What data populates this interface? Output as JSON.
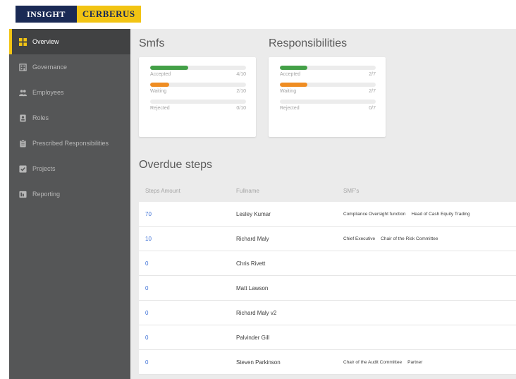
{
  "brand": {
    "left": "INSIGHT",
    "right": "CERBERUS"
  },
  "sidebar": {
    "items": [
      {
        "label": "Overview",
        "icon": "dashboard-icon",
        "active": true
      },
      {
        "label": "Governance",
        "icon": "building-icon"
      },
      {
        "label": "Employees",
        "icon": "people-icon"
      },
      {
        "label": "Roles",
        "icon": "id-badge-icon"
      },
      {
        "label": "Prescribed Responsibilities",
        "icon": "clipboard-icon"
      },
      {
        "label": "Projects",
        "icon": "checkbox-icon"
      },
      {
        "label": "Reporting",
        "icon": "report-icon"
      }
    ]
  },
  "smfs": {
    "title": "Smfs",
    "stats": [
      {
        "label": "Accepted",
        "value": "4/10",
        "fraction": 0.4,
        "color": "#43a047"
      },
      {
        "label": "Waiting",
        "value": "2/10",
        "fraction": 0.2,
        "color": "#ef8d22"
      },
      {
        "label": "Rejected",
        "value": "0/10",
        "fraction": 0.0,
        "color": "#d9d9d9"
      }
    ]
  },
  "responsibilities": {
    "title": "Responsibilities",
    "stats": [
      {
        "label": "Accepted",
        "value": "2/7",
        "fraction": 0.2857,
        "color": "#43a047"
      },
      {
        "label": "Waiting",
        "value": "2/7",
        "fraction": 0.2857,
        "color": "#ef8d22"
      },
      {
        "label": "Rejected",
        "value": "0/7",
        "fraction": 0.0,
        "color": "#d9d9d9"
      }
    ]
  },
  "overdue": {
    "title": "Overdue steps",
    "columns": [
      "Steps Amount",
      "Fullname",
      "SMF's"
    ],
    "rows": [
      {
        "steps": "70",
        "name": "Lesley Kumar",
        "smfs": [
          "Compliance Oversight function",
          "Head of Cash Equity Trading"
        ]
      },
      {
        "steps": "10",
        "name": "Richard Maly",
        "smfs": [
          "Chief Executive",
          "Chair of the Risk Committee"
        ]
      },
      {
        "steps": "0",
        "name": "Chris Rivett",
        "smfs": []
      },
      {
        "steps": "0",
        "name": "Matt Lawson",
        "smfs": []
      },
      {
        "steps": "0",
        "name": "Richard Maly v2",
        "smfs": []
      },
      {
        "steps": "0",
        "name": "Palvinder Gill",
        "smfs": []
      },
      {
        "steps": "0",
        "name": "Steven Parkinson",
        "smfs": [
          "Chair of the Audit Committee",
          "Partner"
        ]
      }
    ]
  },
  "colors": {
    "accent": "#f2c413",
    "navy": "#1a2a55",
    "sidebar": "#555657",
    "link": "#3b6fd6"
  }
}
